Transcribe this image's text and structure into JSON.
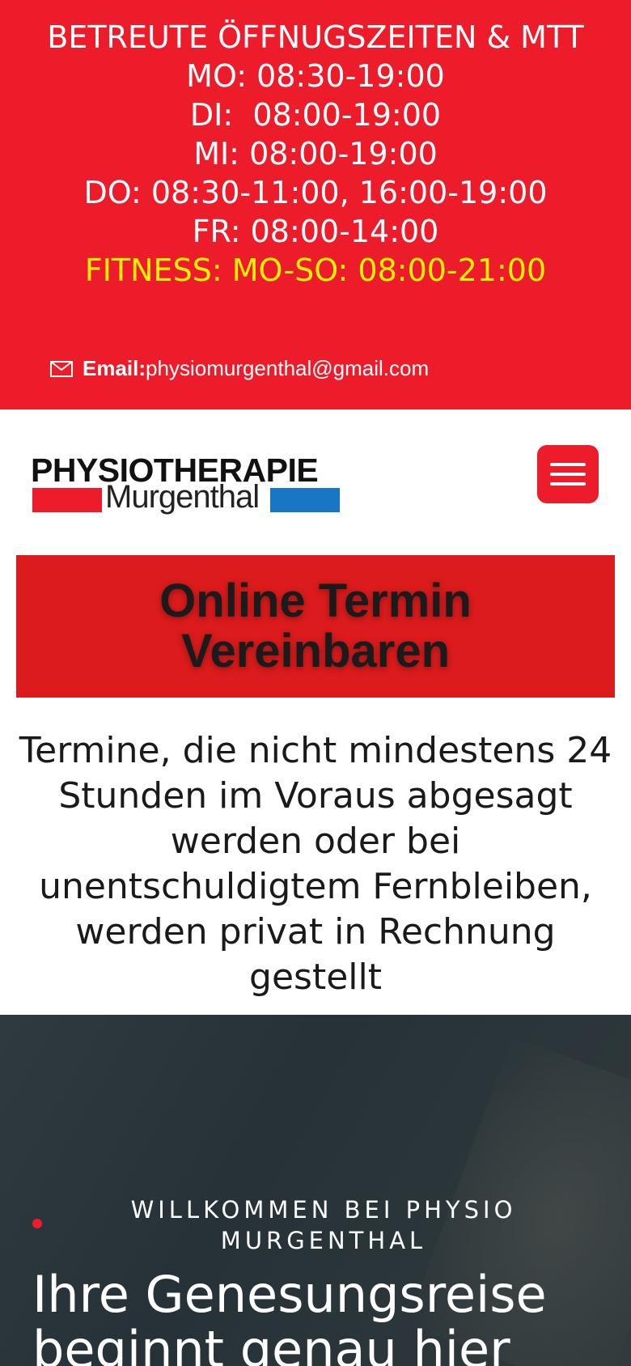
{
  "top_bar": {
    "background_color": "#ed1c2b",
    "hours_title": "BETREUTE ÖFFNUGSZEITEN & MTT",
    "hours": [
      "MO: 08:30-19:00",
      "DI:  08:00-19:00",
      "MI: 08:00-19:00",
      "DO: 08:30-11:00, 16:00-19:00",
      "FR: 08:00-14:00"
    ],
    "fitness_hours": "FITNESS: MO-SO: 08:00-21:00",
    "email_label": "Email:",
    "email_value": "physiomurgenthal@gmail.com",
    "email_icon": "mail-icon"
  },
  "header": {
    "logo_title": "PHYSIOTHERAPIE",
    "logo_subtitle": "Murgenthal",
    "menu_icon": "hamburger-icon"
  },
  "cta": {
    "label": "Online Termin Vereinbaren",
    "background_color": "#db1b1c"
  },
  "notice": {
    "text": "Termine, die nicht mindestens 24 Stunden im Voraus abgesagt werden oder bei unentschuldigtem Fernbleiben, werden privat in Rechnung gestellt"
  },
  "hero": {
    "eyebrow": "WILLKOMMEN BEI PHYSIO MURGENTHAL",
    "headline": "Ihre Genesungsreise beginnt genau hier"
  }
}
